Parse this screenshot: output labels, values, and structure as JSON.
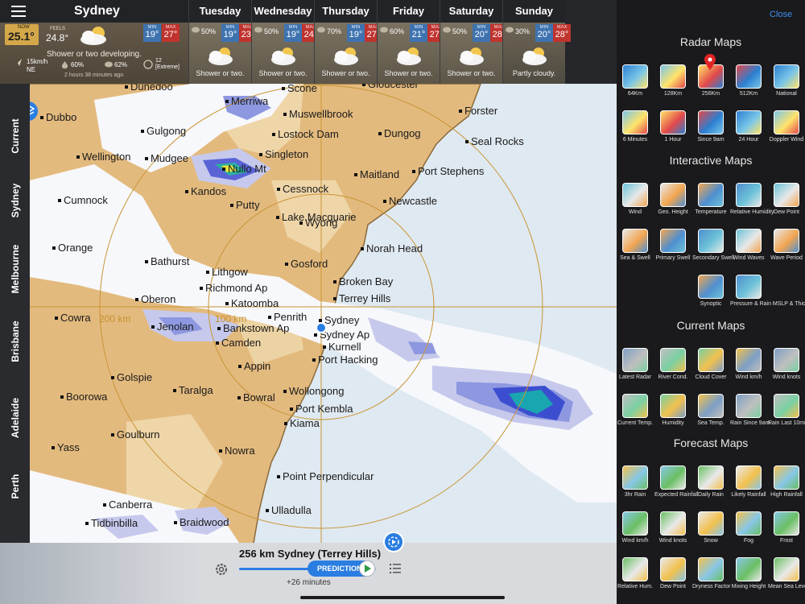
{
  "header": {
    "menu_icon": "hamburger-icon",
    "location": "Sydney",
    "now_label": "NOW",
    "now_temp": "25.1°",
    "feels_label": "FEELS",
    "feels_temp": "24.8°",
    "min_label": "MIN",
    "max_label": "MAX",
    "today_min": "19°",
    "today_max": "27°",
    "summary": "Shower or two developing.",
    "wind_speed": "15km/h",
    "wind_dir": "NE",
    "humidity": "60%",
    "rain_chance": "62%",
    "uv": "12",
    "uv_label": "[Extreme]",
    "updated": "2 hours 38 minutes ago"
  },
  "forecast": [
    {
      "day": "Tuesday",
      "chance": "50%",
      "min": "19°",
      "max": "23°",
      "desc": "Shower or two."
    },
    {
      "day": "Wednesday",
      "chance": "50%",
      "min": "19°",
      "max": "24°",
      "desc": "Shower or two."
    },
    {
      "day": "Thursday",
      "chance": "70%",
      "min": "19°",
      "max": "27°",
      "desc": "Shower or two."
    },
    {
      "day": "Friday",
      "chance": "60%",
      "min": "21°",
      "max": "27°",
      "desc": "Shower or two."
    },
    {
      "day": "Saturday",
      "chance": "50%",
      "min": "20°",
      "max": "28°",
      "desc": "Shower or two."
    },
    {
      "day": "Sunday",
      "chance": "30%",
      "min": "20°",
      "max": "28°",
      "desc": "Partly cloudy."
    }
  ],
  "side_tabs": [
    "Current",
    "Sydney",
    "Melbourne",
    "Brisbane",
    "Adelaide",
    "Perth"
  ],
  "map": {
    "ring_200": "200 km",
    "ring_100": "100 km",
    "places": [
      "Dunedoo",
      "Merriwa",
      "Scone",
      "Gloucester",
      "Forster",
      "Dubbo",
      "Muswellbrook",
      "Gulgong",
      "Lostock Dam",
      "Dungog",
      "Seal Rocks",
      "Wellington",
      "Mudgee",
      "Singleton",
      "Nullo Mt",
      "Maitland",
      "Port Stephens",
      "Kandos",
      "Cessnock",
      "Cumnock",
      "Putty",
      "Newcastle",
      "Lake Macquarie",
      "Orange",
      "Wyong",
      "Norah Head",
      "Bathurst",
      "Gosford",
      "Lithgow",
      "Broken Bay",
      "Richmond Ap",
      "Terrey Hills",
      "Oberon",
      "Katoomba",
      "Penrith",
      "Sydney",
      "Cowra",
      "Jenolan",
      "Bankstown Ap",
      "Sydney Ap",
      "Camden",
      "Kurnell",
      "Port Hacking",
      "Appin",
      "Golspie",
      "Taralga",
      "Wollongong",
      "Boorowa",
      "Bowral",
      "Port Kembla",
      "Goulburn",
      "Kiama",
      "Yass",
      "Nowra",
      "Point Perpendicular",
      "Canberra",
      "Ulladulla",
      "Tidbinbilla",
      "Braidwood"
    ]
  },
  "bottom": {
    "title": "256 km Sydney (Terrey Hills)",
    "prediction": "PREDICTION",
    "offset": "+26 minutes",
    "progress": 0.66
  },
  "panel": {
    "close": "Close",
    "sections": [
      {
        "title": "Radar Maps",
        "items": [
          "64Km",
          "128Km",
          "256Km",
          "512Km",
          "National",
          "6 Minutes",
          "1 Hour",
          "Since 9am",
          "24 Hour",
          "Doppler Wind"
        ]
      },
      {
        "title": "Interactive Maps",
        "items": [
          "Wind",
          "Geo. Height",
          "Temperature",
          "Relative Humidity",
          "Dew Point",
          "Sea & Swell",
          "Primary Swell",
          "Secondary Swell",
          "Wind Waves",
          "Wave Period",
          "Synoptic",
          "Pressure & Rain MSLP & Thick."
        ]
      },
      {
        "title": "Current Maps",
        "items": [
          "Latest Radar",
          "River Cond.",
          "Cloud Cover",
          "Wind km/h",
          "Wind knots",
          "Current Temp.",
          "Humidity",
          "Sea Temp.",
          "Rain Since 9am",
          "Rain Last 10min"
        ]
      },
      {
        "title": "Forecast Maps",
        "items": [
          "3hr Rain",
          "Expected Rainfall",
          "Daily Rain",
          "Likely Rainfall",
          "High Rainfall",
          "Wind km/h",
          "Wind knots",
          "Snow",
          "Fog",
          "Frost",
          "Relative Hum.",
          "Dew Point",
          "Dryness Factor",
          "Mixing Height",
          "Mean Sea Level"
        ]
      }
    ]
  },
  "colors": {
    "accent": "#2a7de1",
    "max_red": "#c0332e",
    "min_blue": "#3e73b0",
    "land": "#e3ba7e",
    "sea": "#dfe9f1"
  }
}
